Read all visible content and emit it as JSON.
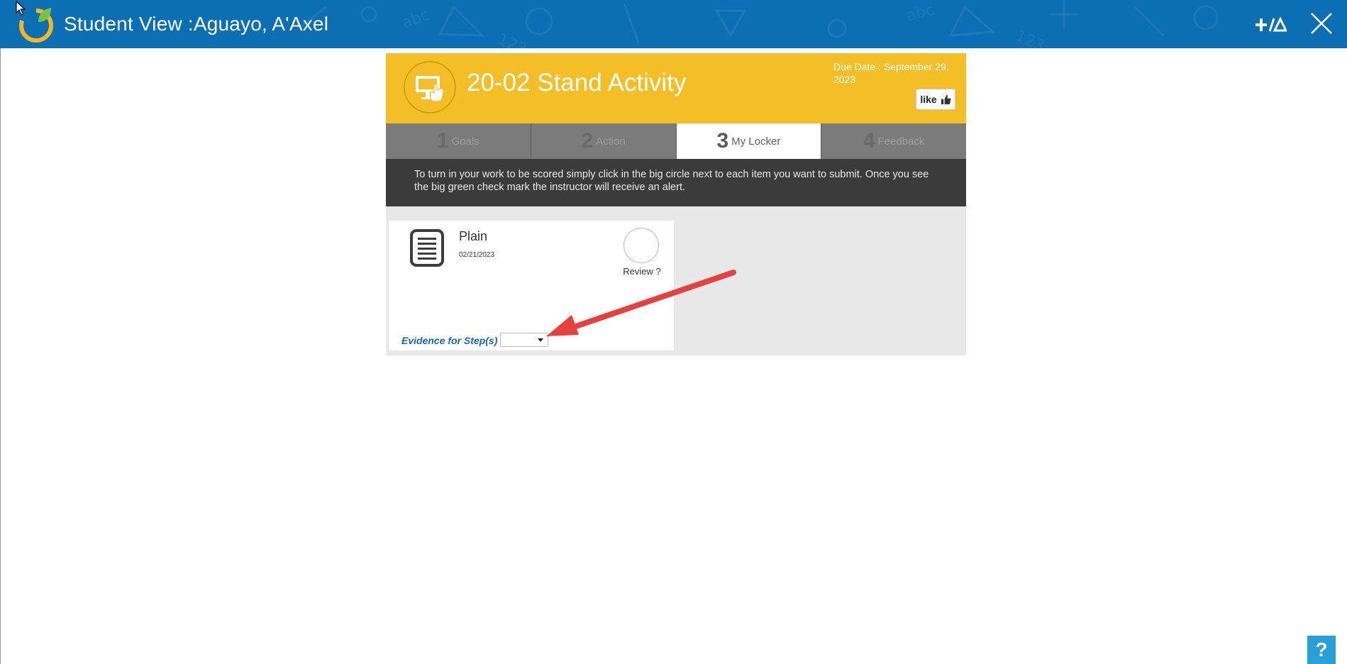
{
  "header": {
    "title": "Student View :Aguayo, A'Axel",
    "bg_color": "#0d6fb3"
  },
  "activity": {
    "title": "20-02 Stand Activity",
    "due_date": "Due Date : September 29, 2023",
    "like_label": "like",
    "header_color": "#f4bf26"
  },
  "tabs": [
    {
      "num": "1",
      "label": "Goals",
      "active": false
    },
    {
      "num": "2",
      "label": "Action",
      "active": false
    },
    {
      "num": "3",
      "label": "My Locker",
      "active": true
    },
    {
      "num": "4",
      "label": "Feedback",
      "active": false
    }
  ],
  "instructions": "To turn in your work to be scored simply click in the big circle next to each item you want to submit. Once you see the big green check mark the instructor will receive an alert.",
  "locker": {
    "items": [
      {
        "name": "Plain",
        "date": "02/21/2023",
        "review_label": "Review ?",
        "evidence_label": "Evidence for Step(s)",
        "evidence_value": ""
      }
    ]
  },
  "help": {
    "label": "?"
  },
  "icons": {
    "logo": "app-logo-icon",
    "tools": "plus-triangle-tools-icon",
    "close": "close-icon",
    "activity": "computer-touch-icon",
    "document": "document-icon",
    "like": "thumbs-up-icon"
  },
  "annotation": {
    "arrow_color": "#e8403f"
  }
}
